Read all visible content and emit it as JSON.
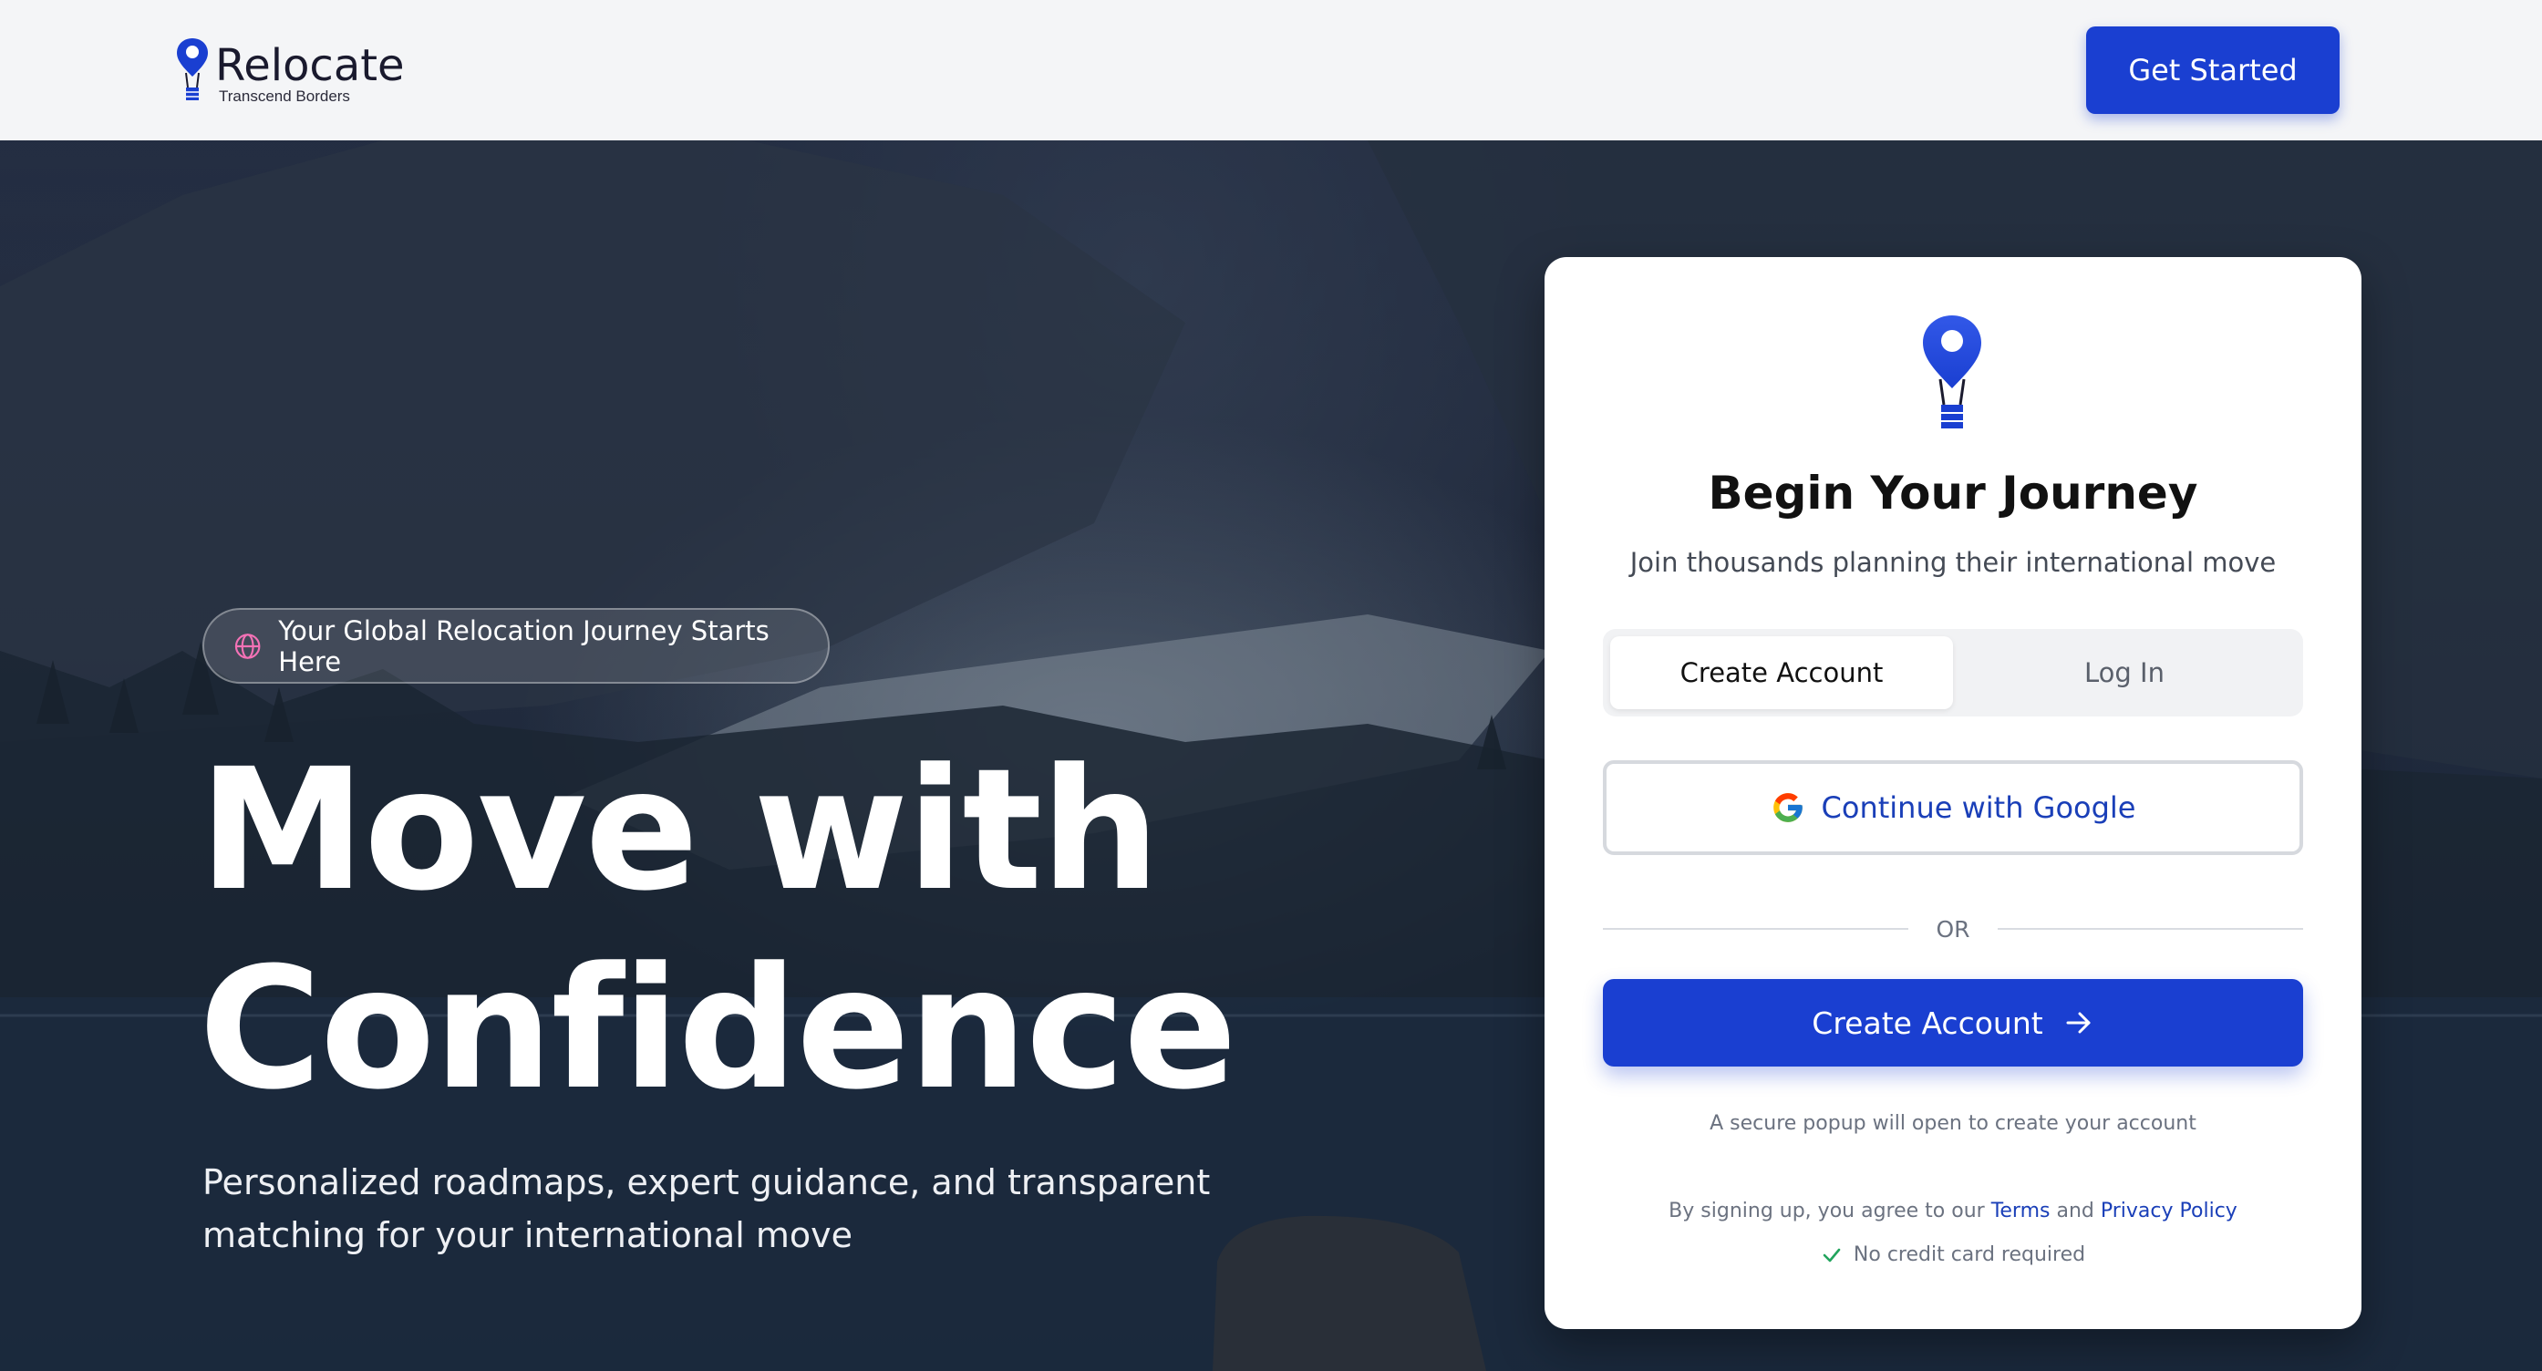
{
  "header": {
    "brand_name": "Relocate",
    "brand_tagline": "Transcend Borders",
    "cta_label": "Get Started"
  },
  "hero": {
    "badge_icon": "globe-icon",
    "badge_text": "Your Global Relocation Journey Starts Here",
    "title_line1": "Move with",
    "title_line2": "Confidence",
    "subtitle": "Personalized roadmaps, expert guidance, and transparent matching for your international move"
  },
  "card": {
    "title": "Begin Your Journey",
    "subtitle": "Join thousands planning their international move",
    "tabs": [
      {
        "label": "Create Account",
        "active": true
      },
      {
        "label": "Log In",
        "active": false
      }
    ],
    "google_label": "Continue with Google",
    "divider_text": "OR",
    "create_label": "Create Account",
    "popup_note": "A secure popup will open to create your account",
    "terms_prefix": "By signing up, you agree to our",
    "terms_link": "Terms",
    "terms_and": "and",
    "privacy_link": "Privacy Policy",
    "no_credit_card": "No credit card required"
  },
  "colors": {
    "accent": "#1a3fd1",
    "link": "#1a3fb8",
    "check": "#22a45d"
  }
}
